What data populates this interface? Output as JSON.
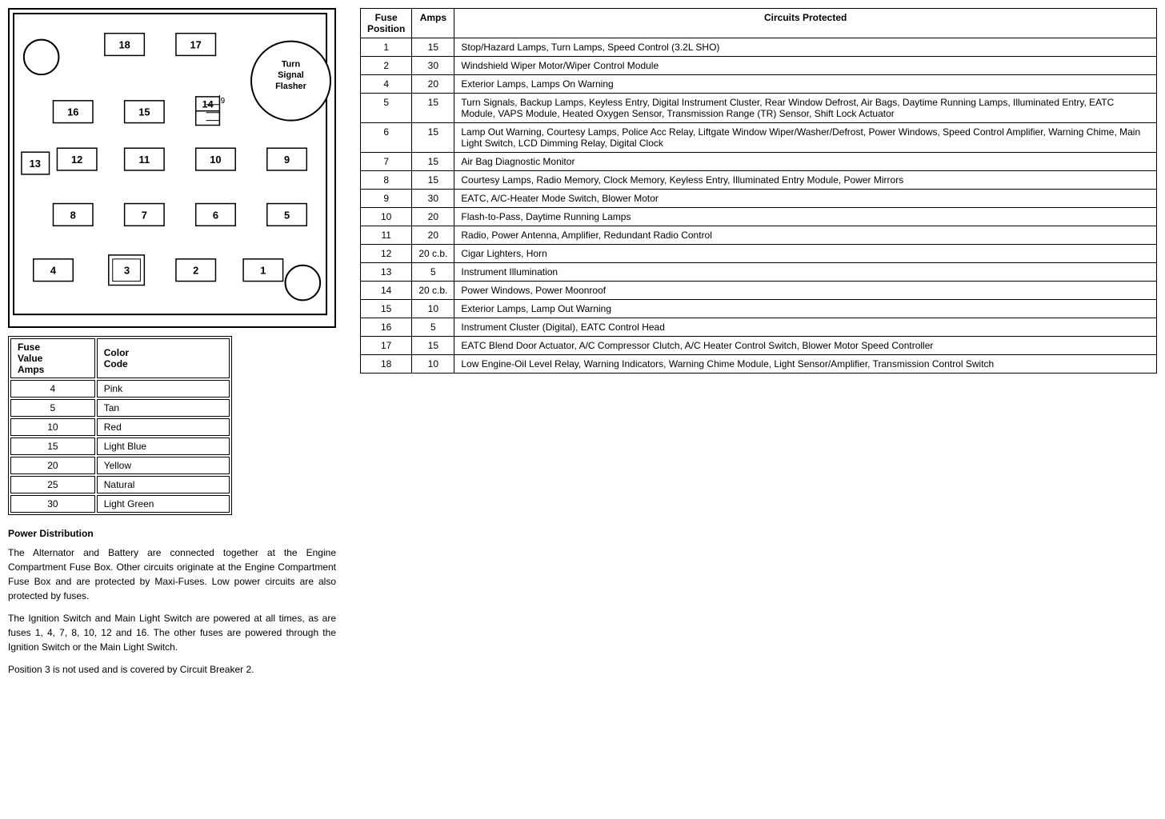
{
  "diagram": {
    "label_turn_signal": "Turn\nSignal\nFlasher",
    "label_c219": "C219",
    "fuse_numbers": [
      "18",
      "17",
      "16",
      "15",
      "14",
      "13",
      "12",
      "11",
      "10",
      "9",
      "8",
      "7",
      "6",
      "5",
      "4",
      "3",
      "2",
      "1"
    ]
  },
  "color_table": {
    "headers": [
      "Fuse\nValue\nAmps",
      "Color\nCode"
    ],
    "rows": [
      {
        "amps": "4",
        "color": "Pink"
      },
      {
        "amps": "5",
        "color": "Tan"
      },
      {
        "amps": "10",
        "color": "Red"
      },
      {
        "amps": "15",
        "color": "Light Blue"
      },
      {
        "amps": "20",
        "color": "Yellow"
      },
      {
        "amps": "25",
        "color": "Natural"
      },
      {
        "amps": "30",
        "color": "Light Green"
      }
    ]
  },
  "power_distribution": {
    "title": "Power Distribution",
    "paragraph1": "The Alternator and Battery are connected together at the Engine Compartment Fuse Box. Other circuits originate at the Engine Compartment Fuse Box and are protected by Maxi-Fuses. Low power circuits are also protected by fuses.",
    "paragraph2": "The Ignition Switch and Main Light Switch are powered at all times, as are fuses 1, 4, 7, 8, 10, 12 and 16. The other fuses are powered through the Ignition Switch or the Main Light Switch.",
    "paragraph3": "Position 3 is not used and is covered by Circuit Breaker 2."
  },
  "fuse_table": {
    "headers": [
      "Fuse\nPosition",
      "Amps",
      "Circuits Protected"
    ],
    "rows": [
      {
        "pos": "1",
        "amps": "15",
        "circuits": "Stop/Hazard Lamps, Turn Lamps, Speed Control (3.2L SHO)"
      },
      {
        "pos": "2",
        "amps": "30",
        "circuits": "Windshield Wiper Motor/Wiper Control Module"
      },
      {
        "pos": "4",
        "amps": "20",
        "circuits": "Exterior Lamps, Lamps On Warning"
      },
      {
        "pos": "5",
        "amps": "15",
        "circuits": "Turn Signals, Backup Lamps, Keyless Entry, Digital Instrument Cluster, Rear Window Defrost, Air Bags, Daytime Running Lamps, Illuminated Entry, EATC Module, VAPS Module, Heated Oxygen Sensor, Transmission Range (TR) Sensor, Shift Lock Actuator"
      },
      {
        "pos": "6",
        "amps": "15",
        "circuits": "Lamp Out Warning, Courtesy Lamps, Police Acc Relay, Liftgate Window Wiper/Washer/Defrost, Power Windows, Speed Control Amplifier, Warning Chime, Main Light Switch, LCD Dimming Relay, Digital Clock"
      },
      {
        "pos": "7",
        "amps": "15",
        "circuits": "Air Bag Diagnostic Monitor"
      },
      {
        "pos": "8",
        "amps": "15",
        "circuits": "Courtesy Lamps, Radio Memory, Clock Memory, Keyless Entry, Illuminated Entry Module, Power Mirrors"
      },
      {
        "pos": "9",
        "amps": "30",
        "circuits": "EATC, A/C-Heater Mode Switch, Blower Motor"
      },
      {
        "pos": "10",
        "amps": "20",
        "circuits": "Flash-to-Pass, Daytime Running Lamps"
      },
      {
        "pos": "11",
        "amps": "20",
        "circuits": "Radio, Power Antenna, Amplifier, Redundant Radio Control"
      },
      {
        "pos": "12",
        "amps": "20 c.b.",
        "circuits": "Cigar Lighters, Horn"
      },
      {
        "pos": "13",
        "amps": "5",
        "circuits": "Instrument Illumination"
      },
      {
        "pos": "14",
        "amps": "20 c.b.",
        "circuits": "Power Windows, Power Moonroof"
      },
      {
        "pos": "15",
        "amps": "10",
        "circuits": "Exterior Lamps, Lamp Out Warning"
      },
      {
        "pos": "16",
        "amps": "5",
        "circuits": "Instrument Cluster (Digital), EATC Control Head"
      },
      {
        "pos": "17",
        "amps": "15",
        "circuits": "EATC Blend Door Actuator, A/C Compressor Clutch, A/C Heater Control Switch, Blower Motor Speed Controller"
      },
      {
        "pos": "18",
        "amps": "10",
        "circuits": "Low Engine-Oil Level Relay, Warning Indicators, Warning Chime Module, Light Sensor/Amplifier, Transmission Control Switch"
      }
    ]
  }
}
